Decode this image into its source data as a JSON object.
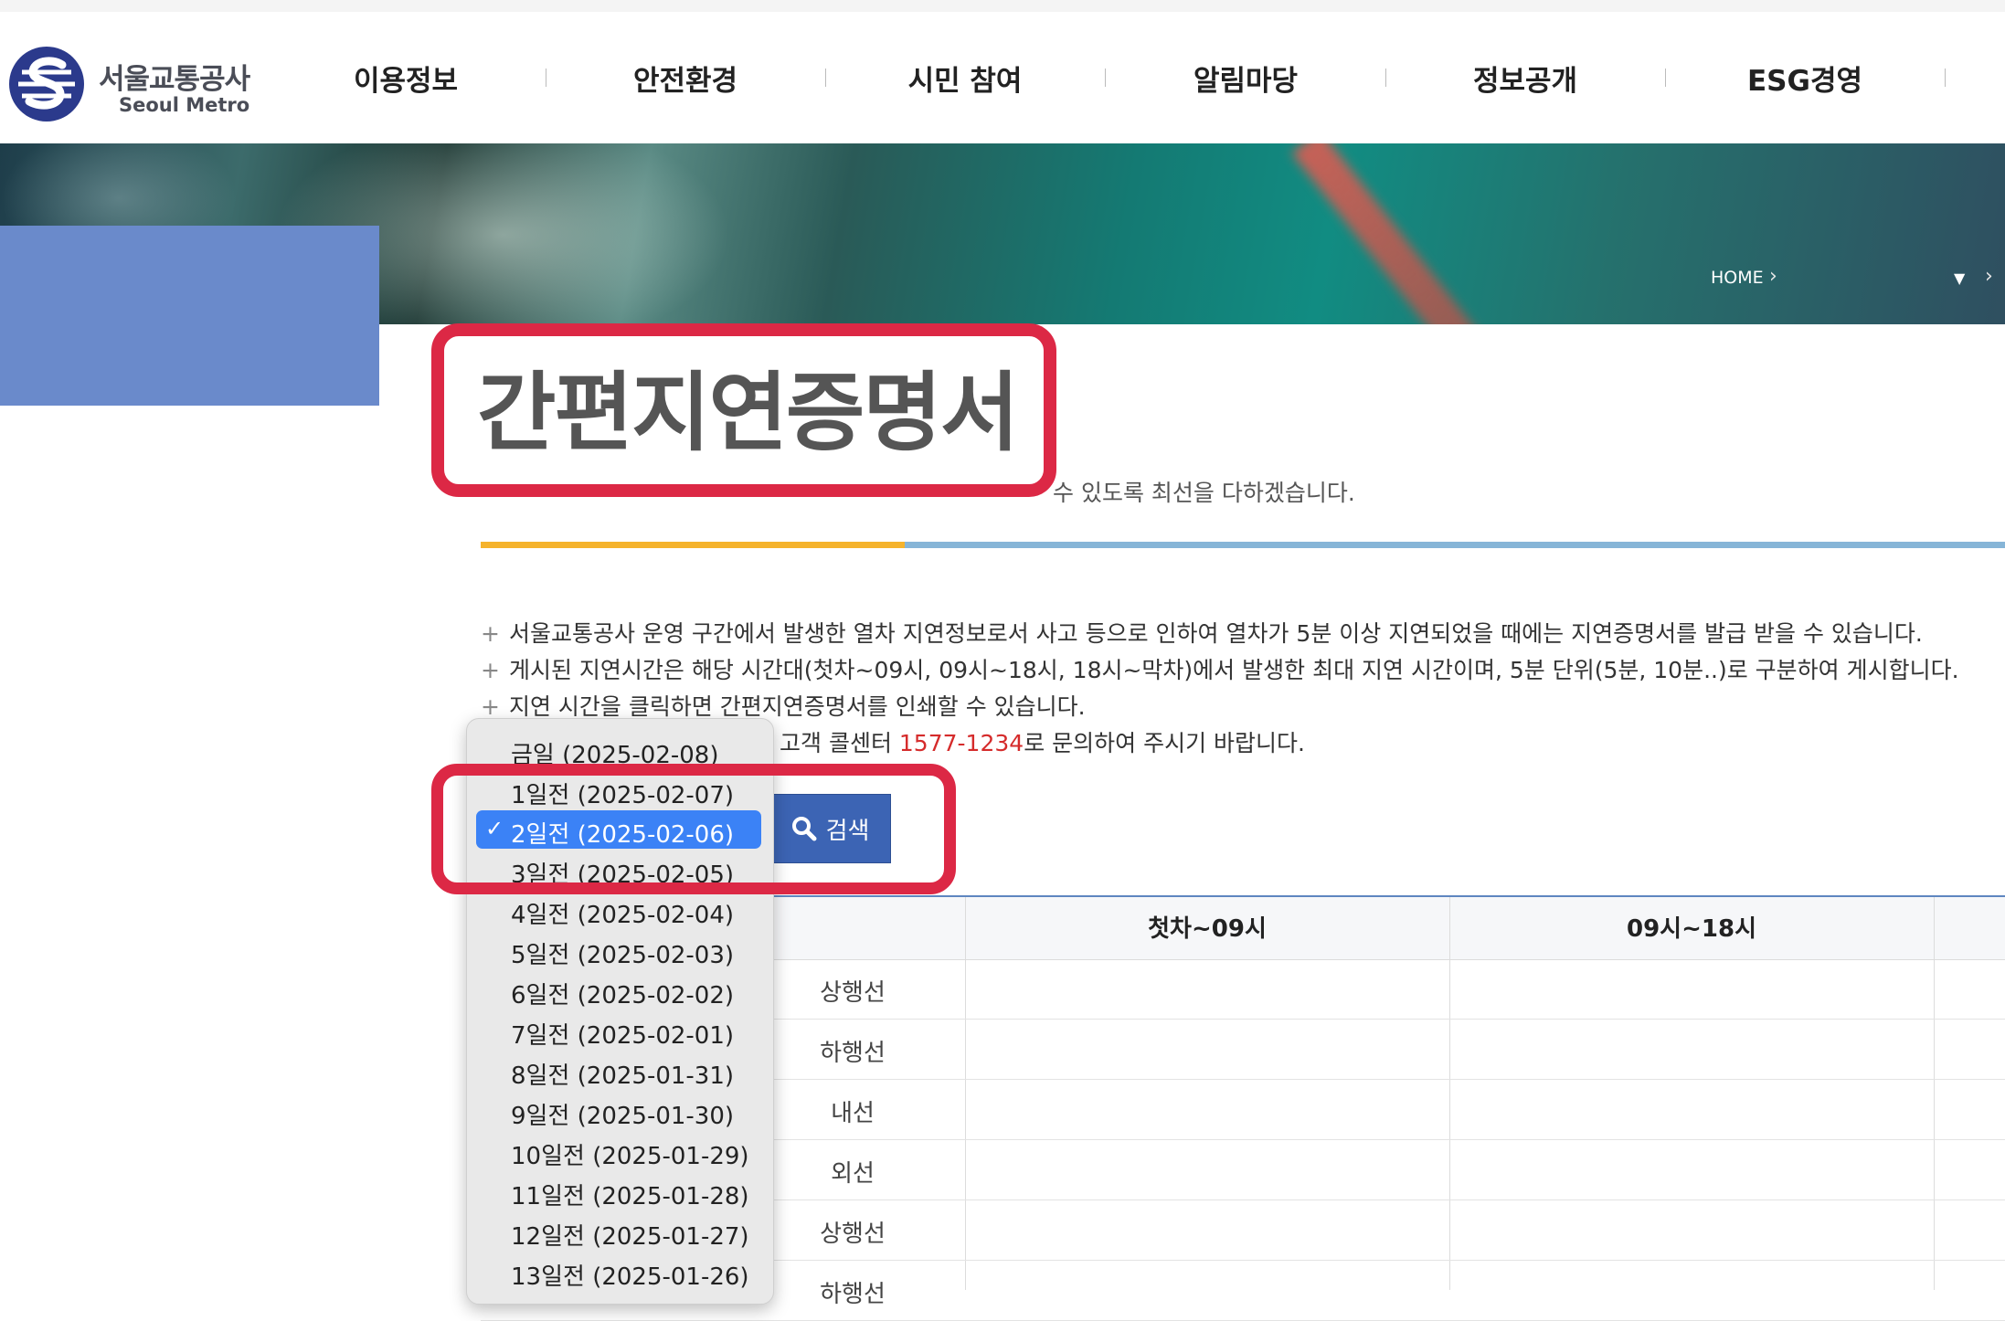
{
  "logo": {
    "name_ko": "서울교통공사",
    "name_en": "Seoul Metro"
  },
  "nav": [
    "이용정보",
    "안전환경",
    "시민 참여",
    "알림마당",
    "정보공개",
    "ESG경영"
  ],
  "breadcrumb": {
    "home": "HOME",
    "sep": "›",
    "dropdown": "▼"
  },
  "page": {
    "title": "간편지연증명서",
    "subtitle": "수 있도록 최선을 다하겠습니다."
  },
  "notices": [
    "서울교통공사 운영 구간에서 발생한 열차 지연정보로서 사고 등으로 인하여 열차가 5분 이상 지연되었을 때에는 지연증명서를 발급 받을 수 있습니다.",
    "게시된 지연시간은 해당 시간대(첫차~09시, 09시~18시, 18시~막차)에서 발생한 최대 지연 시간이며, 5분 단위(5분, 10분..)로 구분하여 게시합니다.",
    "지연 시간을 클릭하면 간편지연증명서를 인쇄할 수 있습니다."
  ],
  "contact": {
    "prefix": "고객 콜센터",
    "phone": "1577-1234",
    "suffix": "로 문의하여 주시기 바랍니다."
  },
  "search": {
    "label": "검색"
  },
  "date_select": {
    "options": [
      "금일 (2025-02-08)",
      "1일전 (2025-02-07)",
      "2일전 (2025-02-06)",
      "3일전 (2025-02-05)",
      "4일전 (2025-02-04)",
      "5일전 (2025-02-03)",
      "6일전 (2025-02-02)",
      "7일전 (2025-02-01)",
      "8일전 (2025-01-31)",
      "9일전 (2025-01-30)",
      "10일전 (2025-01-29)",
      "11일전 (2025-01-28)",
      "12일전 (2025-01-27)",
      "13일전 (2025-01-26)"
    ],
    "selected_index": 2,
    "check_mark": "✓"
  },
  "table": {
    "headers": [
      "첫차~09시",
      "09시~18시"
    ],
    "rows": [
      "상행선",
      "하행선",
      "내선",
      "외선",
      "상행선",
      "하행선"
    ]
  },
  "colors": {
    "accent": "#dc2845",
    "brand_blue": "#3c64b4",
    "orange": "#f5b32c",
    "selected": "#3b82f6",
    "phone": "#d52b2b"
  }
}
